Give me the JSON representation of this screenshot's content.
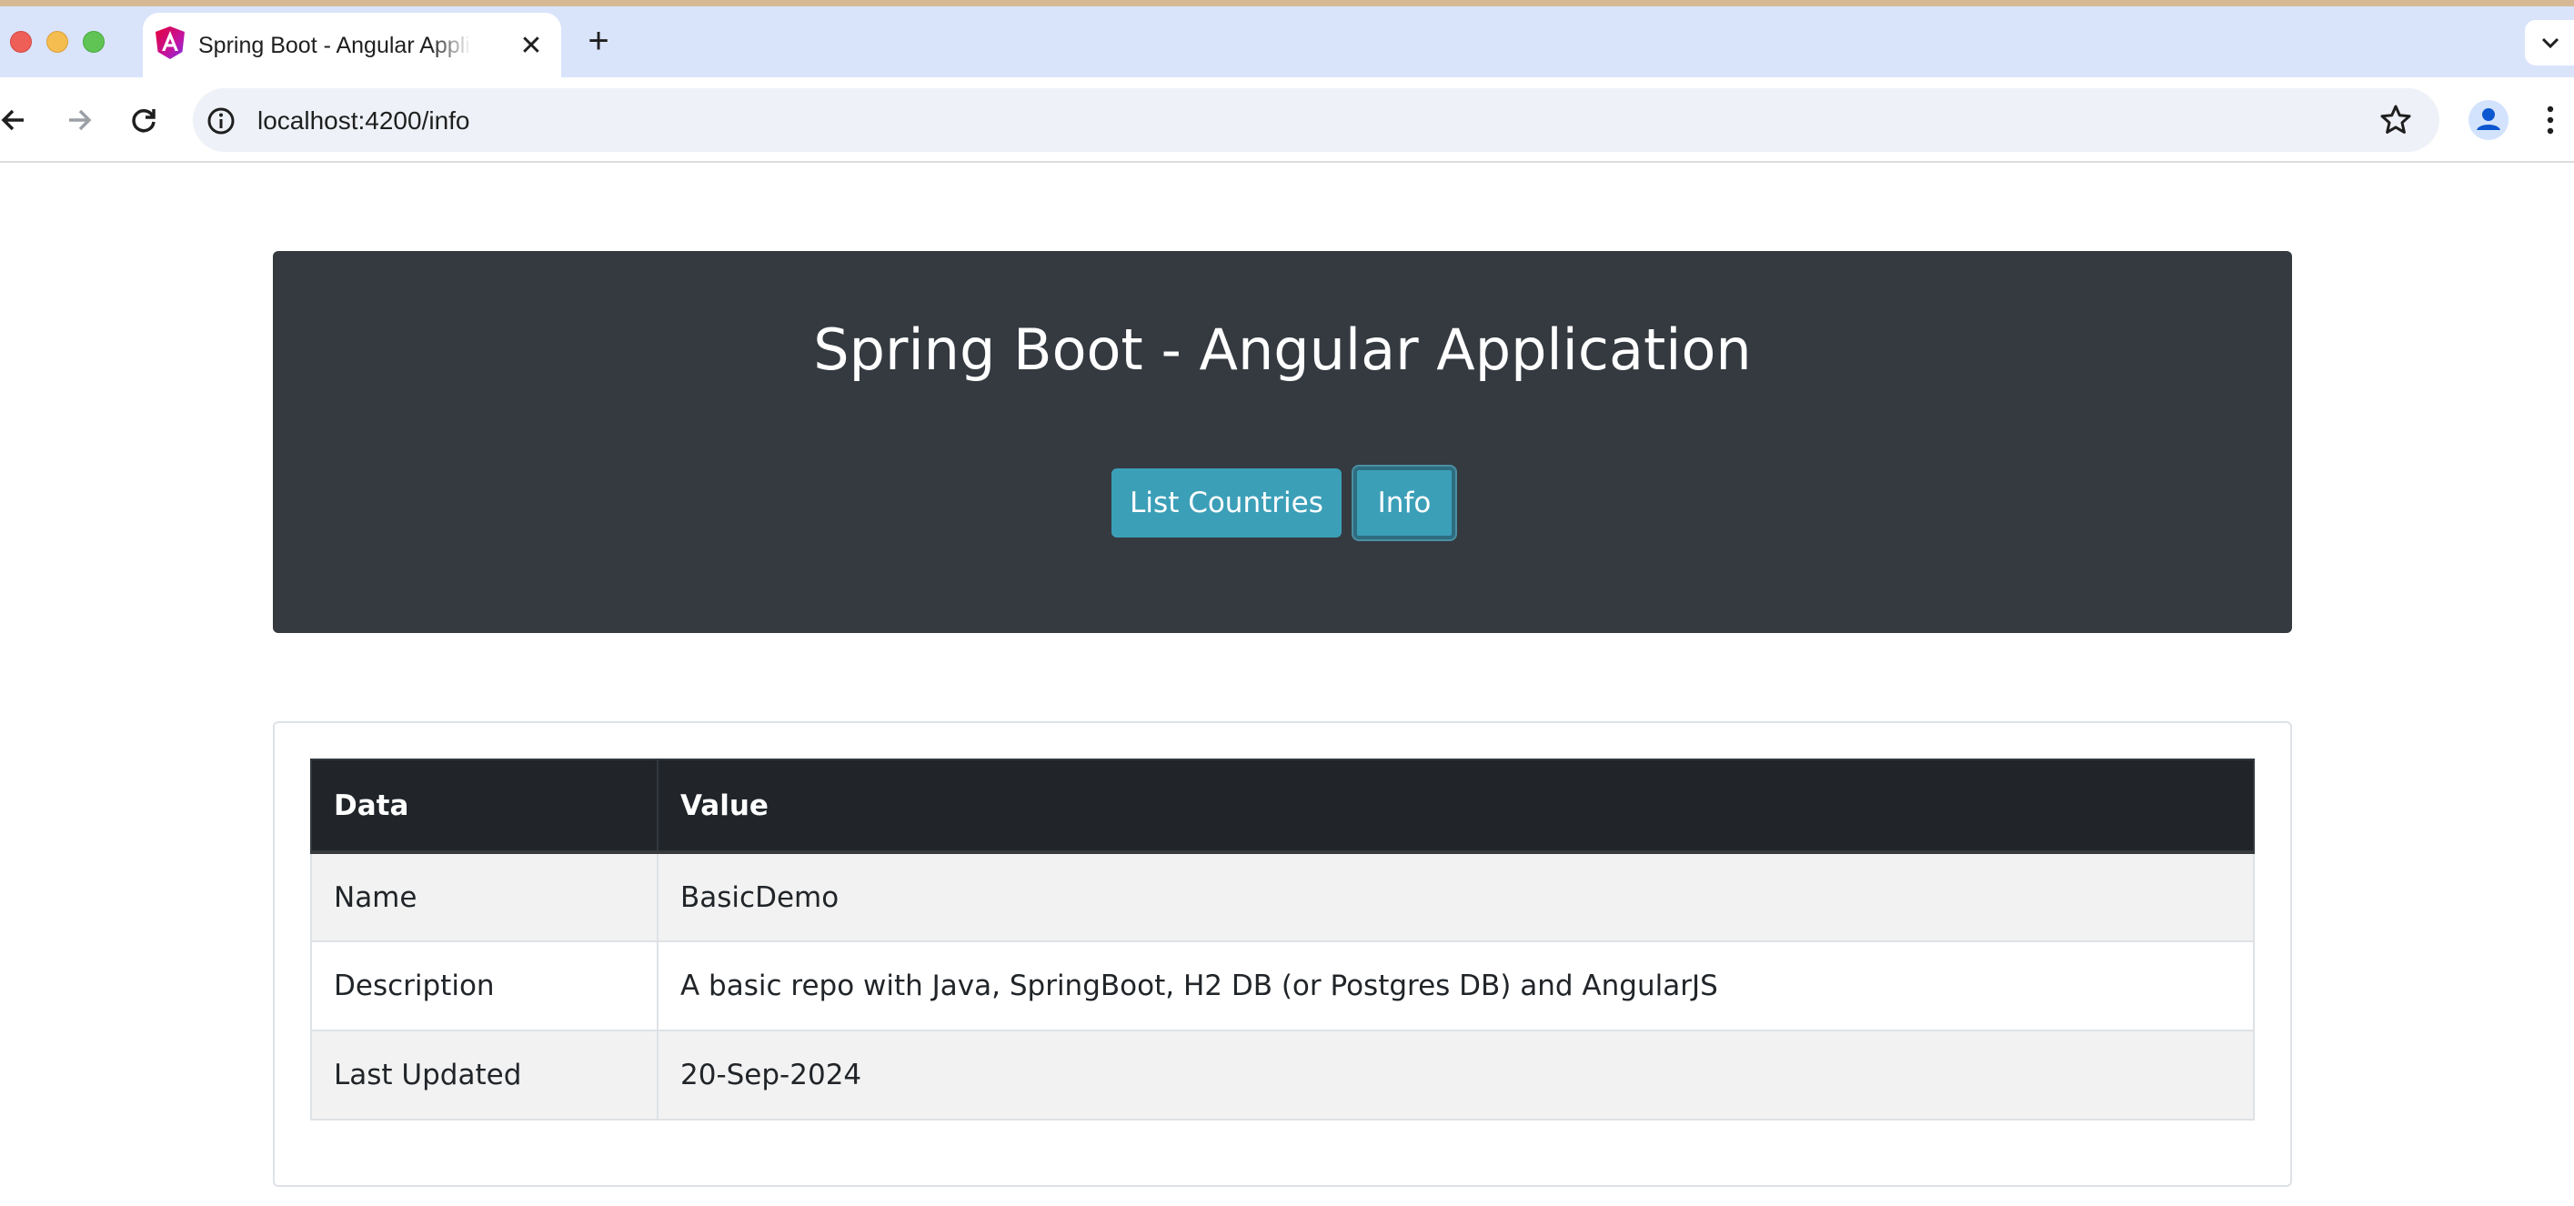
{
  "browser": {
    "tab_title": "Spring Boot - Angular Application",
    "close_glyph": "✕",
    "new_tab_glyph": "+",
    "url": "localhost:4200/info"
  },
  "header": {
    "title": "Spring Boot - Angular Application",
    "buttons": {
      "list_countries": "List Countries",
      "info": "Info"
    }
  },
  "table": {
    "columns": [
      "Data",
      "Value"
    ],
    "rows": [
      {
        "data": "Name",
        "value": "BasicDemo"
      },
      {
        "data": "Description",
        "value": "A basic repo with Java, SpringBoot, H2 DB (or Postgres DB) and AngularJS"
      },
      {
        "data": "Last Updated",
        "value": "20-Sep-2024"
      }
    ]
  },
  "colors": {
    "hero_bg": "#343a40",
    "button_bg": "#3c9fb8",
    "table_header_bg": "#212529",
    "table_stripe": "#f2f2f2",
    "tabstrip_bg": "#d9e4fb"
  }
}
